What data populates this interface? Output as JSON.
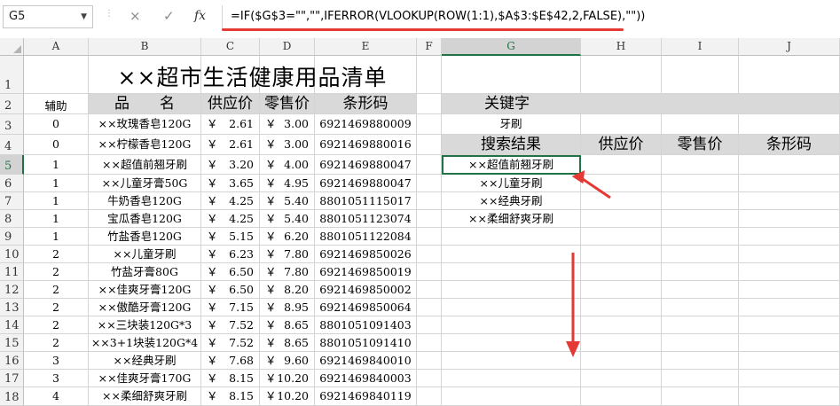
{
  "formula_bar": {
    "name_box": "G5",
    "cancel_icon": "×",
    "enter_icon": "✓",
    "fx_label": "fx",
    "formula": "=IF($G$3=\"\",\"\",IFERROR(VLOOKUP(ROW(1:1),$A$3:$E$42,2,FALSE),\"\"))"
  },
  "columns": [
    "A",
    "B",
    "C",
    "D",
    "E",
    "F",
    "G",
    "H",
    "I",
    "J"
  ],
  "rows": [
    "1",
    "2",
    "3",
    "4",
    "5",
    "6",
    "7",
    "8",
    "9",
    "10",
    "11",
    "12",
    "13",
    "14",
    "15",
    "16",
    "17",
    "18"
  ],
  "selected_column": "G",
  "selected_row": "5",
  "sheet": {
    "title": "××超市生活健康用品清单",
    "headers": {
      "aux": "辅助",
      "name": "品　　名",
      "supply": "供应价",
      "retail": "零售价",
      "barcode": "条形码"
    },
    "currency": "￥",
    "products": [
      {
        "aux": "0",
        "name": "××玫瑰香皂120G",
        "supply": "2.61",
        "retail": "3.00",
        "barcode": "6921469880009"
      },
      {
        "aux": "0",
        "name": "××柠檬香皂120G",
        "supply": "2.61",
        "retail": "3.00",
        "barcode": "6921469880016"
      },
      {
        "aux": "1",
        "name": "××超值前翘牙刷",
        "supply": "3.20",
        "retail": "4.00",
        "barcode": "6921469880047"
      },
      {
        "aux": "1",
        "name": "××儿童牙膏50G",
        "supply": "3.65",
        "retail": "4.95",
        "barcode": "6921469880047"
      },
      {
        "aux": "1",
        "name": "牛奶香皂120G",
        "supply": "4.25",
        "retail": "5.40",
        "barcode": "8801051115017"
      },
      {
        "aux": "1",
        "name": "宝瓜香皂120G",
        "supply": "4.25",
        "retail": "5.40",
        "barcode": "8801051123074"
      },
      {
        "aux": "1",
        "name": "竹盐香皂120G",
        "supply": "5.15",
        "retail": "6.20",
        "barcode": "8801051122084"
      },
      {
        "aux": "2",
        "name": "××儿童牙刷",
        "supply": "6.23",
        "retail": "7.80",
        "barcode": "6921469850026"
      },
      {
        "aux": "2",
        "name": "竹盐牙膏80G",
        "supply": "6.50",
        "retail": "7.80",
        "barcode": "6921469850019"
      },
      {
        "aux": "2",
        "name": "××佳爽牙膏120G",
        "supply": "6.50",
        "retail": "8.20",
        "barcode": "6921469850002"
      },
      {
        "aux": "2",
        "name": "××傲酷牙膏120G",
        "supply": "7.15",
        "retail": "8.95",
        "barcode": "6921469850064"
      },
      {
        "aux": "2",
        "name": "××三块装120G*3",
        "supply": "7.52",
        "retail": "8.65",
        "barcode": "8801051091403"
      },
      {
        "aux": "2",
        "name": "××3+1块装120G*4",
        "supply": "7.52",
        "retail": "8.65",
        "barcode": "8801051091410"
      },
      {
        "aux": "3",
        "name": "××经典牙刷",
        "supply": "7.68",
        "retail": "9.60",
        "barcode": "6921469840010"
      },
      {
        "aux": "3",
        "name": "××佳爽牙膏170G",
        "supply": "8.15",
        "retail": "10.20",
        "barcode": "6921469840003"
      },
      {
        "aux": "4",
        "name": "××柔细舒爽牙刷",
        "supply": "8.15",
        "retail": "10.20",
        "barcode": "6921469840119"
      }
    ],
    "search": {
      "keyword_label": "关键字",
      "keyword": "牙刷",
      "result_headers": {
        "result": "搜索结果",
        "supply": "供应价",
        "retail": "零售价",
        "barcode": "条形码"
      },
      "results": [
        "××超值前翘牙刷",
        "××儿童牙刷",
        "××经典牙刷",
        "××柔细舒爽牙刷"
      ]
    }
  },
  "colors": {
    "header_fill": "#d9d9d9",
    "selection": "#217346",
    "annotation": "#e53935"
  }
}
